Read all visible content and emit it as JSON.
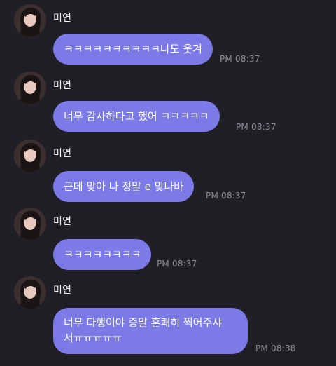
{
  "messages": [
    {
      "sender": "미연",
      "text": "ㅋㅋㅋㅋㅋㅋㅋㅋㅋㅋ나도 웃겨",
      "time": "PM 08:37"
    },
    {
      "sender": "미연",
      "text": "너무 감사하다고 했어 ㅋㅋㅋㅋㅋ",
      "time": "PM 08:37"
    },
    {
      "sender": "미연",
      "text": "근데 맞아 나 정말 e 맞나바",
      "time": "PM 08:37"
    },
    {
      "sender": "미연",
      "text": "ㅋㅋㅋㅋㅋㅋㅋㅋ",
      "time": "PM 08:37"
    },
    {
      "sender": "미연",
      "text": "너무 다행이야 증말 흔쾌히 찍어주샤\n서ㅠㅠㅠㅠㅠ",
      "time": "PM 08:38"
    }
  ],
  "icons": {
    "avatar": "profile-photo"
  },
  "colors": {
    "background": "#1f1f25",
    "bubble": "#7c7ae6",
    "timestamp": "#8e8e97",
    "text": "#ffffff"
  }
}
